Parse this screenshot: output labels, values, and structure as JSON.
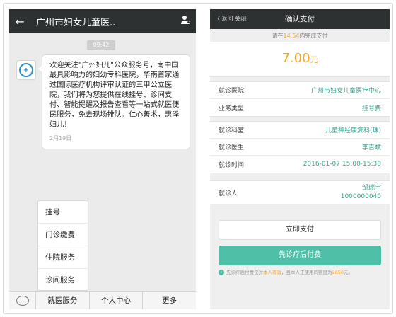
{
  "chat": {
    "title": "广州市妇女儿童医..",
    "time_badge": "09:42",
    "message": "欢迎关注\"广州妇儿\"公众服务号，南中国最具影响力的妇幼专科医院，华南首家通过国际医疗机构评审认证的三甲公立医院，我们将为您提供在线挂号、诊间支付、智能提醒及报告查看等一站式就医便民服务，免去现场排队。仁心善术，惠泽妇儿！",
    "date": "2月19日",
    "menu": [
      "挂号",
      "门诊缴费",
      "住院服务",
      "诊间服务"
    ],
    "tabs": [
      "就医服务",
      "个人中心",
      "更多"
    ]
  },
  "payment": {
    "back_label": "〈 返回  关闭",
    "title": "确认支付",
    "deadline_prefix": "请在",
    "deadline_time": "14:54",
    "deadline_suffix": "内完成支付",
    "amount": "7.00",
    "amount_unit": "元",
    "rows_a": [
      {
        "label": "就诊医院",
        "value": "广州市妇女儿童医疗中心"
      },
      {
        "label": "业务类型",
        "value": "挂号费"
      }
    ],
    "rows_b": [
      {
        "label": "就诊科室",
        "value": "儿童神经康复科(珠)"
      },
      {
        "label": "就诊医生",
        "value": "李吉斌"
      },
      {
        "label": "就诊时间",
        "value": "2016-01-07 15:00-15:30"
      }
    ],
    "patient": {
      "label": "就诊人",
      "name": "邹瑞宇",
      "id": "1000000040"
    },
    "pay_now": "立即支付",
    "pay_later": "先诊疗后付费",
    "note_prefix": "先诊疗后付费仅对",
    "note_highlight": "本人有效",
    "note_middle": "，且本人正使用的额度为",
    "note_amount": "2650",
    "note_suffix": "元。"
  },
  "colors": {
    "header": "#2e3132",
    "accent_green": "#4fbfa8",
    "value_green": "#3aa28e",
    "amount_orange": "#f5a623"
  }
}
